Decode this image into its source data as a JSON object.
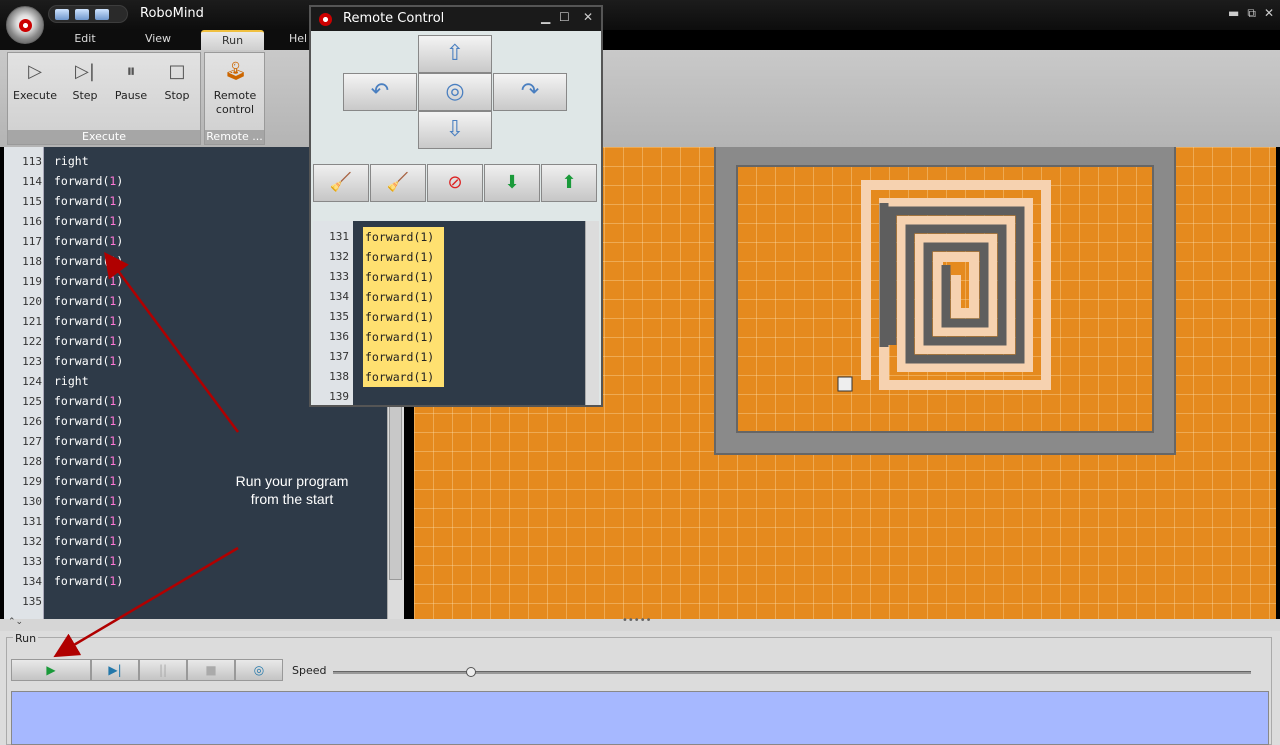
{
  "app": {
    "title": "RoboMind"
  },
  "window_controls": {
    "minimize": "▬",
    "restore": "⧉",
    "close": "✕"
  },
  "tabs": [
    {
      "label": "Edit"
    },
    {
      "label": "View"
    },
    {
      "label": "Run"
    },
    {
      "label": "Hel"
    }
  ],
  "ribbon": {
    "execute_group": {
      "caption": "Execute",
      "buttons": [
        {
          "label": "Execute",
          "icon": "play-icon"
        },
        {
          "label": "Step",
          "icon": "step-icon"
        },
        {
          "label": "Pause",
          "icon": "pause-icon"
        },
        {
          "label": "Stop",
          "icon": "stop-icon"
        }
      ]
    },
    "remote_group": {
      "caption": "Remote ...",
      "button": {
        "label1": "Remote",
        "label2": "control",
        "icon": "joystick-icon"
      }
    }
  },
  "editor": {
    "lines": [
      {
        "n": "113",
        "cmd": "right",
        "arg": ""
      },
      {
        "n": "114",
        "cmd": "forward",
        "arg": "1"
      },
      {
        "n": "115",
        "cmd": "forward",
        "arg": "1"
      },
      {
        "n": "116",
        "cmd": "forward",
        "arg": "1"
      },
      {
        "n": "117",
        "cmd": "forward",
        "arg": "1"
      },
      {
        "n": "118",
        "cmd": "forward",
        "arg": "1"
      },
      {
        "n": "119",
        "cmd": "forward",
        "arg": "1"
      },
      {
        "n": "120",
        "cmd": "forward",
        "arg": "1"
      },
      {
        "n": "121",
        "cmd": "forward",
        "arg": "1"
      },
      {
        "n": "122",
        "cmd": "forward",
        "arg": "1"
      },
      {
        "n": "123",
        "cmd": "forward",
        "arg": "1"
      },
      {
        "n": "124",
        "cmd": "right",
        "arg": ""
      },
      {
        "n": "125",
        "cmd": "forward",
        "arg": "1"
      },
      {
        "n": "126",
        "cmd": "forward",
        "arg": "1"
      },
      {
        "n": "127",
        "cmd": "forward",
        "arg": "1"
      },
      {
        "n": "128",
        "cmd": "forward",
        "arg": "1"
      },
      {
        "n": "129",
        "cmd": "forward",
        "arg": "1"
      },
      {
        "n": "130",
        "cmd": "forward",
        "arg": "1"
      },
      {
        "n": "131",
        "cmd": "forward",
        "arg": "1"
      },
      {
        "n": "132",
        "cmd": "forward",
        "arg": "1"
      },
      {
        "n": "133",
        "cmd": "forward",
        "arg": "1"
      },
      {
        "n": "134",
        "cmd": "forward",
        "arg": "1"
      },
      {
        "n": "135",
        "cmd": "",
        "arg": ""
      }
    ]
  },
  "remote": {
    "title": "Remote Control",
    "pad": {
      "up": "⇧",
      "left": "↶",
      "center": "◎",
      "right": "↷",
      "down": "⇩"
    },
    "tools": [
      {
        "icon": "broom-icon",
        "glyph": "🧹"
      },
      {
        "icon": "broom-icon",
        "glyph": "🧹"
      },
      {
        "icon": "no-paint-icon",
        "glyph": "⊘"
      },
      {
        "icon": "pickup-icon",
        "glyph": "⬇"
      },
      {
        "icon": "putdown-icon",
        "glyph": "⬆"
      }
    ],
    "lines": [
      {
        "n": "131",
        "code": "forward(1)"
      },
      {
        "n": "132",
        "code": "forward(1)"
      },
      {
        "n": "133",
        "code": "forward(1)"
      },
      {
        "n": "134",
        "code": "forward(1)"
      },
      {
        "n": "135",
        "code": "forward(1)"
      },
      {
        "n": "136",
        "code": "forward(1)"
      },
      {
        "n": "137",
        "code": "forward(1)"
      },
      {
        "n": "138",
        "code": "forward(1)"
      },
      {
        "n": "139",
        "code": ""
      }
    ]
  },
  "annotation": {
    "line1": "Run your program",
    "line2": "from the start"
  },
  "run_panel": {
    "caption": "Run",
    "speed_label": "Speed",
    "speed_value": 0.15,
    "buttons": [
      {
        "icon": "play-icon",
        "glyph": "▶"
      },
      {
        "icon": "step-icon",
        "glyph": "▶|"
      },
      {
        "icon": "pause-icon",
        "glyph": "||"
      },
      {
        "icon": "stop-icon",
        "glyph": "■"
      },
      {
        "icon": "remote-icon",
        "glyph": "◎"
      }
    ]
  },
  "colors": {
    "editor_bg": "#2e3a48",
    "world_floor": "#e58a1e",
    "highlight": "#ffe070",
    "output_bg": "#a6b8ff"
  }
}
